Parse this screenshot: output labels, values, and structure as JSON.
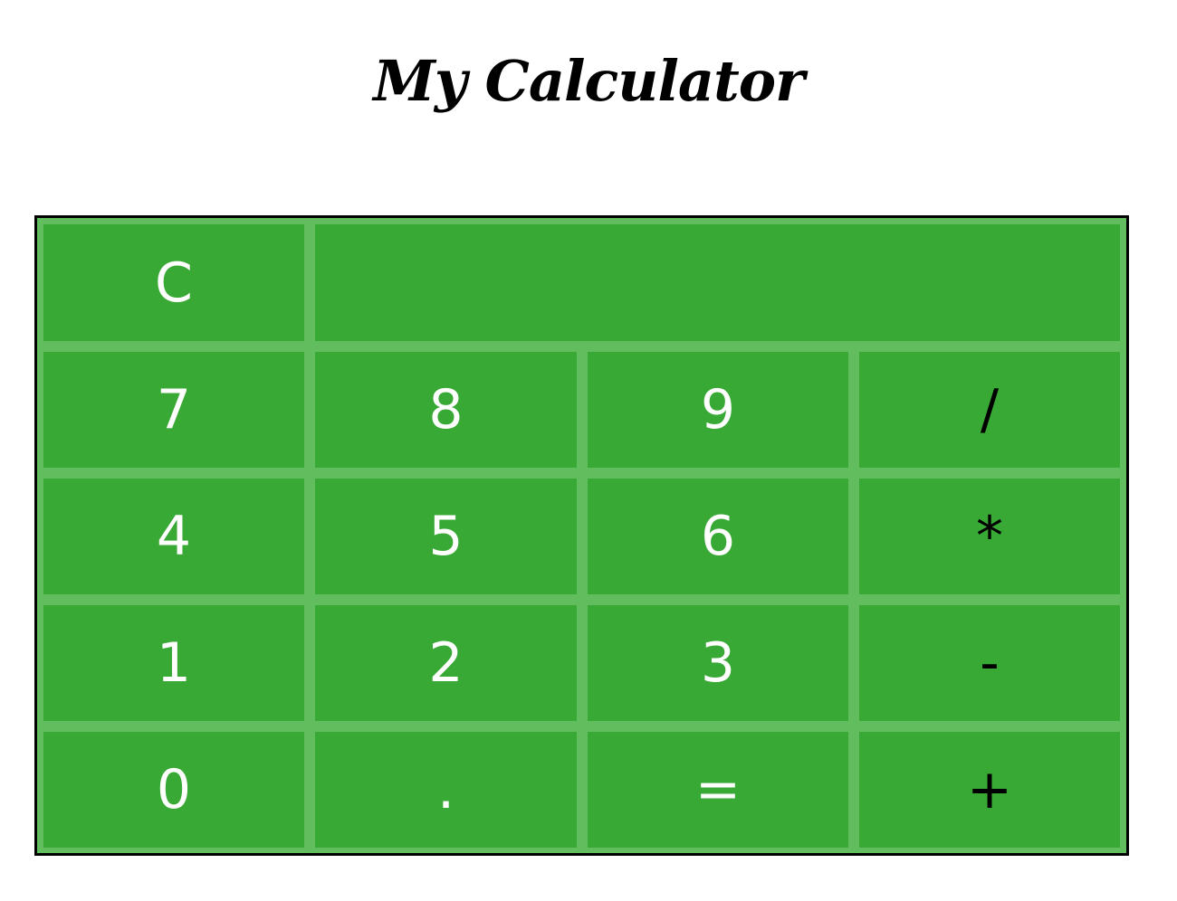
{
  "title": "My Calculator",
  "colors": {
    "button_bg": "#39a935",
    "grid_gap": "#62bd5e",
    "border": "#000000",
    "digit_text": "#ffffff",
    "operator_text": "#000000"
  },
  "display": {
    "value": ""
  },
  "buttons": {
    "clear": "C",
    "seven": "7",
    "eight": "8",
    "nine": "9",
    "divide": "/",
    "four": "4",
    "five": "5",
    "six": "6",
    "multiply": "*",
    "one": "1",
    "two": "2",
    "three": "3",
    "subtract": "-",
    "zero": "0",
    "decimal": ".",
    "equals": "=",
    "add": "+"
  }
}
